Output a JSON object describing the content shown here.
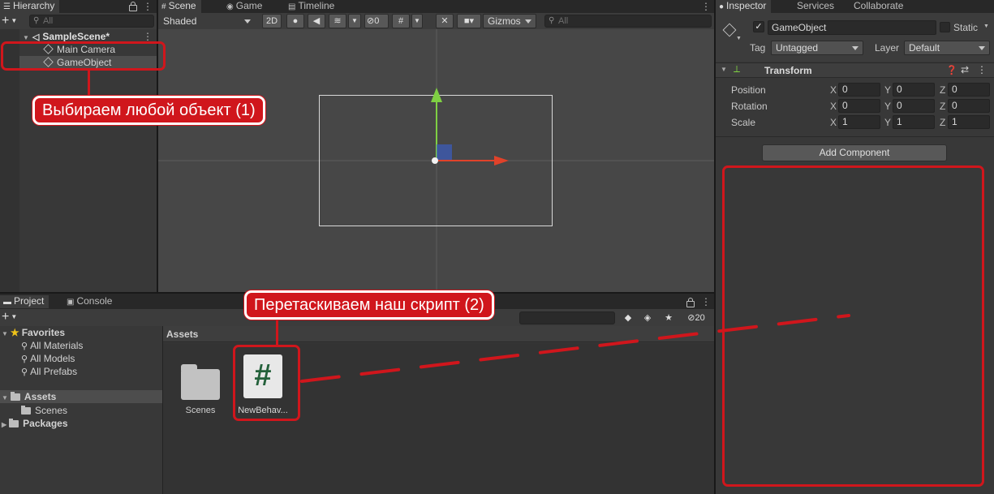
{
  "hierarchy": {
    "tab_label": "Hierarchy",
    "add_label": "+",
    "search_placeholder": "All",
    "scene_name": "SampleScene*",
    "items": [
      {
        "label": "Main Camera"
      },
      {
        "label": "GameObject"
      }
    ]
  },
  "scene_view": {
    "tabs": [
      {
        "label": "Scene"
      },
      {
        "label": "Game"
      },
      {
        "label": "Timeline"
      }
    ],
    "shading_mode": "Shaded",
    "mode_2d_label": "2D",
    "hidden_count": "0",
    "gizmos_label": "Gizmos",
    "search_placeholder": "All"
  },
  "inspector": {
    "tabs": [
      {
        "label": "Inspector"
      },
      {
        "label": "Services"
      },
      {
        "label": "Collaborate"
      }
    ],
    "object_name": "GameObject",
    "static_label": "Static",
    "tag_label": "Tag",
    "tag_value": "Untagged",
    "layer_label": "Layer",
    "layer_value": "Default",
    "transform": {
      "title": "Transform",
      "rows": [
        {
          "label": "Position",
          "x": "0",
          "y": "0",
          "z": "0"
        },
        {
          "label": "Rotation",
          "x": "0",
          "y": "0",
          "z": "0"
        },
        {
          "label": "Scale",
          "x": "1",
          "y": "1",
          "z": "1"
        }
      ],
      "axis_x": "X",
      "axis_y": "Y",
      "axis_z": "Z"
    },
    "add_component_label": "Add Component"
  },
  "project": {
    "tabs": [
      {
        "label": "Project"
      },
      {
        "label": "Console"
      }
    ],
    "add_label": "+",
    "hidden_count": "20",
    "tree": {
      "favorites_label": "Favorites",
      "favorites": [
        {
          "label": "All Materials"
        },
        {
          "label": "All Models"
        },
        {
          "label": "All Prefabs"
        }
      ],
      "assets_label": "Assets",
      "scenes_label": "Scenes",
      "packages_label": "Packages"
    },
    "breadcrumb": "Assets",
    "assets": [
      {
        "label": "Scenes"
      },
      {
        "label": "NewBehav..."
      }
    ],
    "script_glyph": "#"
  },
  "annotations": {
    "step1": "Выбираем любой объект (1)",
    "step2": "Перетаскиваем наш скрипт (2)"
  },
  "colors": {
    "annotation_red": "#d0161c",
    "gizmo_green": "#7fd043",
    "gizmo_red": "#e0422a",
    "gizmo_blue": "#3a5cc0"
  }
}
